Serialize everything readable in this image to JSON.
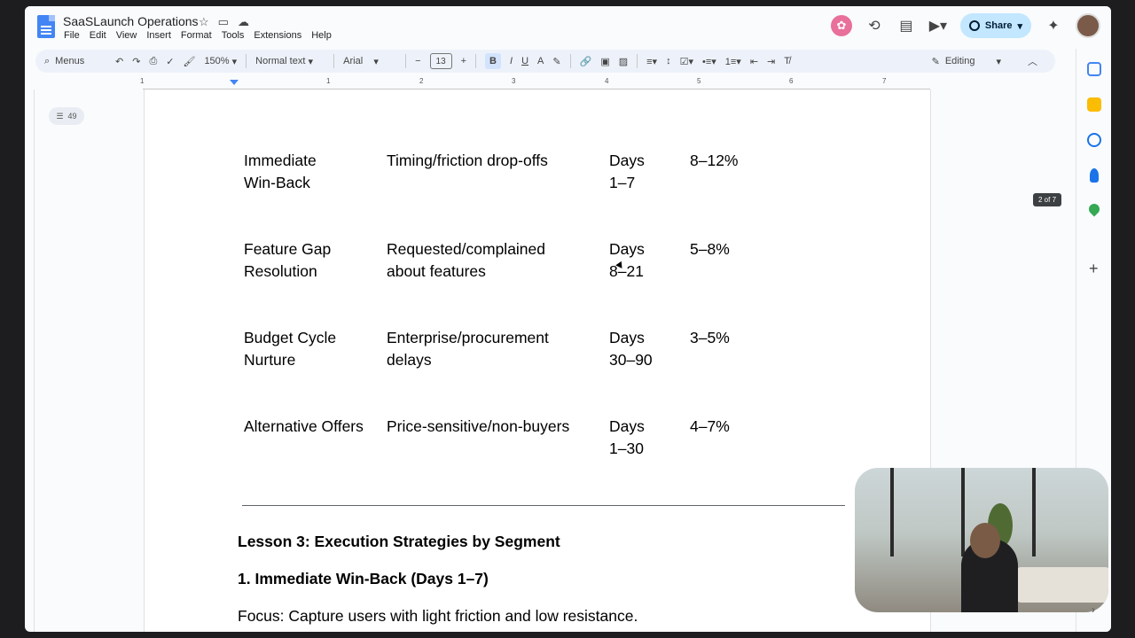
{
  "doc": {
    "title": "SaaSLaunch Operations",
    "menu": [
      "File",
      "Edit",
      "View",
      "Insert",
      "Format",
      "Tools",
      "Extensions",
      "Help"
    ]
  },
  "topbar": {
    "share_label": "Share"
  },
  "toolbar": {
    "search_label": "Menus",
    "zoom": "150%",
    "style": "Normal text",
    "font": "Arial",
    "font_size": "13",
    "mode": "Editing"
  },
  "ruler": {
    "numbers": [
      "1",
      "1",
      "2",
      "3",
      "4",
      "5",
      "6",
      "7"
    ]
  },
  "outline": {
    "count": "49"
  },
  "page_indicator": "2 of 7",
  "table": [
    {
      "strategy": [
        "Immediate",
        "Win-Back"
      ],
      "target": [
        "Timing/friction drop-offs"
      ],
      "timing": [
        "Days",
        "1–7"
      ],
      "rate": "8–12%"
    },
    {
      "strategy": [
        "Feature Gap",
        "Resolution"
      ],
      "target": [
        "Requested/complained",
        "about features"
      ],
      "timing": [
        "Days",
        "8–21"
      ],
      "rate": "5–8%"
    },
    {
      "strategy": [
        "Budget Cycle",
        "Nurture"
      ],
      "target": [
        "Enterprise/procurement",
        "delays"
      ],
      "timing": [
        "Days",
        "30–90"
      ],
      "rate": "3–5%"
    },
    {
      "strategy": [
        "Alternative Offers"
      ],
      "target": [
        "Price-sensitive/non-buyers"
      ],
      "timing": [
        "Days",
        "1–30"
      ],
      "rate": "4–7%"
    }
  ],
  "body": {
    "lesson_heading": "Lesson 3: Execution Strategies by Segment",
    "section_heading": "1. Immediate Win-Back (Days 1–7)",
    "focus_line": "Focus: Capture users with light friction and low resistance."
  },
  "colors": {
    "share_bg": "#c2e7ff",
    "toolbar_bg": "#edf2fa",
    "docs_blue": "#4285f4"
  }
}
